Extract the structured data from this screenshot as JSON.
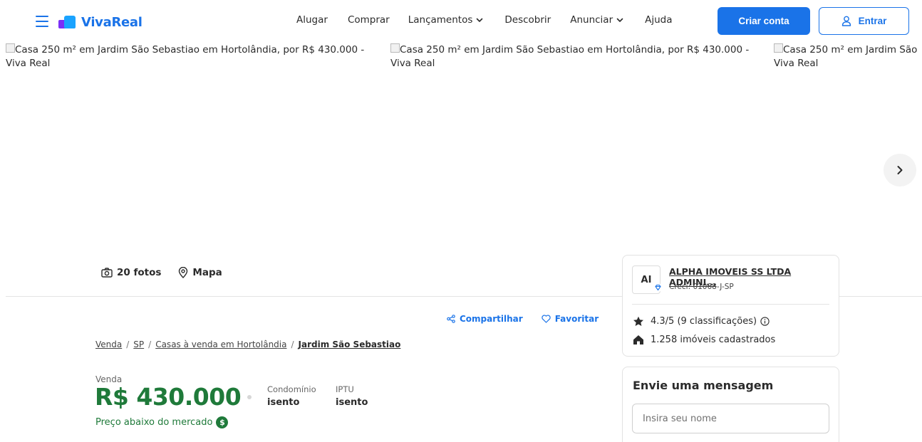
{
  "header": {
    "logo_text": "VivaReal",
    "nav": [
      {
        "label": "Alugar",
        "dropdown": false
      },
      {
        "label": "Comprar",
        "dropdown": false
      },
      {
        "label": "Lançamentos",
        "dropdown": true
      },
      {
        "label": "Descobrir",
        "dropdown": false
      },
      {
        "label": "Anunciar",
        "dropdown": true
      },
      {
        "label": "Ajuda",
        "dropdown": false
      }
    ],
    "create_account_label": "Criar conta",
    "login_label": "Entrar"
  },
  "gallery": {
    "images": [
      {
        "alt_line1": "Casa 250 m² em Jardim São Sebastiao em Hortolândia, por R$ 430.000 -",
        "alt_line2": "Viva Real"
      },
      {
        "alt_line1": "Casa 250 m² em Jardim São Sebastiao em Hortolândia, por R$ 430.000 -",
        "alt_line2": "Viva Real"
      },
      {
        "alt_line1": "Casa 250 m² em Jardim São",
        "alt_line2": "Viva Real"
      }
    ]
  },
  "media": {
    "photos_label": "20 fotos",
    "map_label": "Mapa"
  },
  "actions": {
    "share_label": "Compartilhar",
    "favorite_label": "Favoritar"
  },
  "breadcrumb": {
    "items": [
      "Venda",
      "SP",
      "Casas à venda em Hortolândia"
    ],
    "current": "Jardim São Sebastiao",
    "separator": "/"
  },
  "listing": {
    "transaction_label": "Venda",
    "price": "R$ 430.000",
    "condo_label": "Condomínio",
    "condo_value": "isento",
    "iptu_label": "IPTU",
    "iptu_value": "isento",
    "price_note": "Preço abaixo do mercado",
    "price_note_badge": "$"
  },
  "agency": {
    "initials": "AI",
    "name": "ALPHA IMOVEIS SS LTDA ADMINI...",
    "creci": "Creci: 01068-J-SP",
    "rating": "4.3/5 (9 classificações)",
    "listings": "1.258 imóveis cadastrados"
  },
  "message": {
    "title": "Envie uma mensagem",
    "name_placeholder": "Insira seu nome"
  },
  "colors": {
    "brand_blue": "#1a73e8",
    "price_green": "#1f7a3a"
  }
}
